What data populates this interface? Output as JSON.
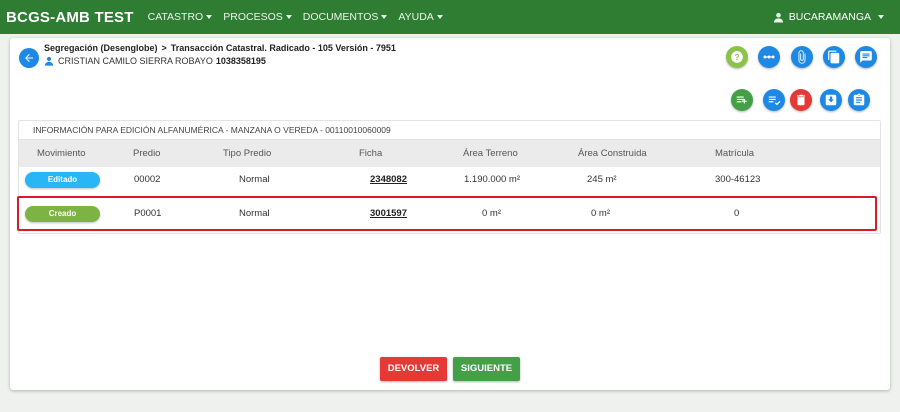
{
  "navbar": {
    "brand": "BCGS-AMB TEST",
    "menu": [
      {
        "label": "CATASTRO"
      },
      {
        "label": "PROCESOS"
      },
      {
        "label": "DOCUMENTOS"
      },
      {
        "label": "AYUDA"
      }
    ],
    "user": "BUCARAMANGA"
  },
  "header": {
    "breadcrumb_first": "Segregación (Desenglobe)",
    "breadcrumb_second": "Transacción Catastral. Radicado - 105 Versión - 7951",
    "person_name": "CRISTIAN CAMILO SIERRA ROBAYO",
    "person_doc": "1038358195"
  },
  "top_actions": [
    {
      "icon": "help-icon",
      "color": "#8bc34a"
    },
    {
      "icon": "more-icon",
      "color": "#1e88e5"
    },
    {
      "icon": "attachment-icon",
      "color": "#1e88e5"
    },
    {
      "icon": "copy-icon",
      "color": "#1e88e5"
    },
    {
      "icon": "comment-icon",
      "color": "#1e88e5"
    }
  ],
  "row_actions": [
    {
      "icon": "playlist-add-icon",
      "color": "#43a047"
    },
    {
      "icon": "playlist-check-icon",
      "color": "#1e88e5"
    },
    {
      "icon": "delete-icon",
      "color": "#e53935"
    },
    {
      "icon": "download-icon",
      "color": "#1e88e5"
    },
    {
      "icon": "clipboard-icon",
      "color": "#1e88e5"
    }
  ],
  "table": {
    "title": "INFORMACIÓN PARA EDICIÓN ALFANUMÉRICA - MANZANA O VEREDA - 00110010060009",
    "columns": [
      "Movimiento",
      "Predio",
      "Tipo Predio",
      "Ficha",
      "Área Terreno",
      "Área Construida",
      "Matrícula"
    ],
    "rows": [
      {
        "movimiento": "Editado",
        "color": "#29b6f6",
        "predio": "00002",
        "tipo": "Normal",
        "ficha": "2348082",
        "area_terreno": "1.190.000 m²",
        "area_construida": "245 m²",
        "matricula": "300-46123"
      },
      {
        "movimiento": "Creado",
        "color": "#7cb342",
        "predio": "P0001",
        "tipo": "Normal",
        "ficha": "3001597",
        "area_terreno": "0 m²",
        "area_construida": "0 m²",
        "matricula": "0"
      }
    ]
  },
  "footer": {
    "devolver": "DEVOLVER",
    "devolver_color": "#e53935",
    "siguiente": "SIGUIENTE",
    "siguiente_color": "#43a047"
  }
}
